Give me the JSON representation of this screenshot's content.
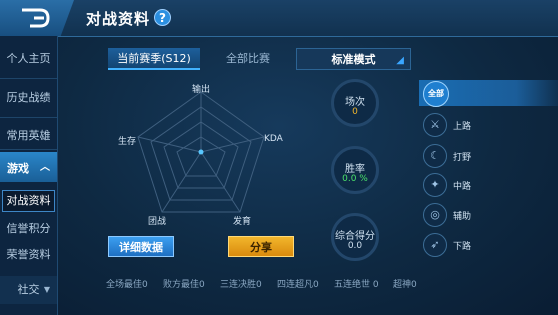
{
  "header": {
    "title": "对战资料",
    "help": "?"
  },
  "sidebar": {
    "items": [
      {
        "label": "个人主页"
      },
      {
        "label": "历史战绩"
      },
      {
        "label": "常用英雄"
      }
    ],
    "group": {
      "label": "游戏"
    },
    "sub_items": [
      {
        "label": "对战资料"
      },
      {
        "label": "信誉积分"
      },
      {
        "label": "荣誉资料"
      }
    ],
    "social": {
      "label": "社交"
    }
  },
  "tabs": {
    "current": "当前赛季(S12)",
    "all": "全部比赛",
    "mode": "标准模式"
  },
  "radar": {
    "labels": [
      "输出",
      "KDA",
      "发育",
      "团战",
      "生存"
    ]
  },
  "buttons": {
    "detail": "详细数据",
    "share": "分享"
  },
  "stats": {
    "matches": {
      "label": "场次",
      "value": "0",
      "color": "#f2b62c"
    },
    "winrate": {
      "label": "胜率",
      "value": "0.0 %",
      "color": "#4be26b"
    },
    "score": {
      "label": "综合得分",
      "value": "0.0",
      "color": "#cfe0ef"
    }
  },
  "lanes": [
    {
      "label": "全部",
      "icon": "all-icon"
    },
    {
      "label": "上路",
      "icon": "top-lane-icon"
    },
    {
      "label": "打野",
      "icon": "jungle-icon"
    },
    {
      "label": "中路",
      "icon": "mid-lane-icon"
    },
    {
      "label": "辅助",
      "icon": "support-icon"
    },
    {
      "label": "下路",
      "icon": "bottom-lane-icon"
    }
  ],
  "achievements": [
    {
      "label": "全场最佳0"
    },
    {
      "label": "败方最佳0"
    },
    {
      "label": "三连决胜0"
    },
    {
      "label": "四连超凡0"
    },
    {
      "label": "五连绝世 0"
    },
    {
      "label": "超神0"
    }
  ],
  "colors": {
    "accent": "#3aa6ff",
    "share": "#f2b62c",
    "winrate": "#4be26b"
  }
}
